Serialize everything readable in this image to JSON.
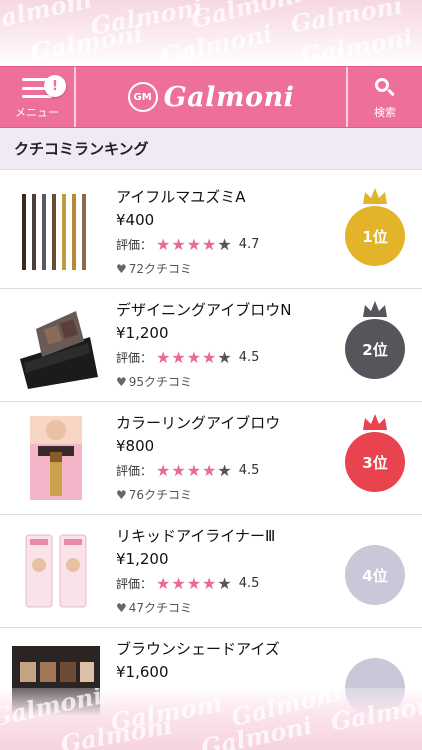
{
  "colors": {
    "brand_pink": "#ef6f9c",
    "star_pink": "#e86a9b",
    "rank1": "#e3b32a",
    "rank2": "#55555c",
    "rank3": "#e8434f",
    "rank_other": "#c9c7d8"
  },
  "watermark": "Galmoni",
  "header": {
    "menu_label": "メニュー",
    "menu_badge": "!",
    "logo_mark": "GM",
    "logo_text": "Galmoni",
    "search_label": "検索"
  },
  "section_title": "クチコミランキング",
  "rating_label": "評価：",
  "stars_display": "★★★★",
  "half_star": "★",
  "items": [
    {
      "name": "アイフルマユズミA",
      "price": "¥400",
      "score": "4.7",
      "reviews": "72クチコミ",
      "rank": "1位",
      "thumb_icon": "eyebrow-pencils-image"
    },
    {
      "name": "デザイニングアイブロウN",
      "price": "¥1,200",
      "score": "4.5",
      "reviews": "95クチコミ",
      "rank": "2位",
      "thumb_icon": "eyebrow-palette-image"
    },
    {
      "name": "カラーリングアイブロウ",
      "price": "¥800",
      "score": "4.5",
      "reviews": "76クチコミ",
      "rank": "3位",
      "thumb_icon": "eyebrow-mascara-image"
    },
    {
      "name": "リキッドアイライナーⅢ",
      "price": "¥1,200",
      "score": "4.5",
      "reviews": "47クチコミ",
      "rank": "4位",
      "thumb_icon": "eyeliner-pack-image"
    },
    {
      "name": "ブラウンシェードアイズ",
      "price": "¥1,600",
      "score": "",
      "reviews": "",
      "rank": "",
      "thumb_icon": "eyeshadow-palette-image"
    }
  ]
}
